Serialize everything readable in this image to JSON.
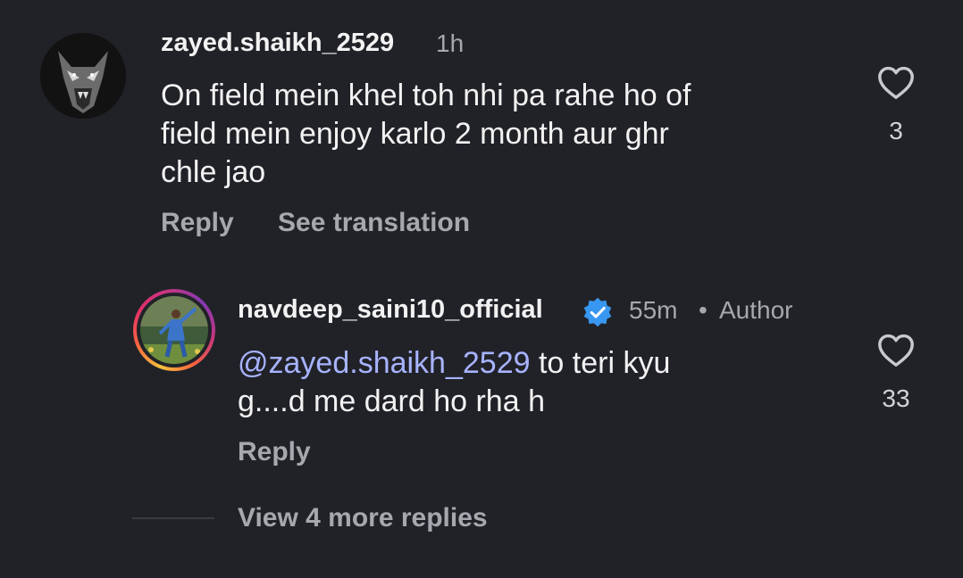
{
  "comment": {
    "username": "zayed.shaikh_2529",
    "time": "1h",
    "text_lines": [
      "On field mein khel toh nhi  pa rahe ho of",
      "field mein enjoy karlo 2 month aur ghr",
      "chle jao"
    ],
    "reply_label": "Reply",
    "translation_label": "See translation",
    "like_count": "3",
    "avatar_icon": "wolf-avatar-icon"
  },
  "reply": {
    "username": "navdeep_saini10_official",
    "verified_icon": "verified-badge-icon",
    "time": "55m",
    "separator": "•",
    "author_label": "Author",
    "mention": "@zayed.shaikh_2529",
    "text_after_mention": " to teri kyu",
    "text_line2": "g....d me dard ho rha h",
    "reply_label": "Reply",
    "like_count": "33",
    "avatar_icon": "cricketer-avatar-icon"
  },
  "view_more_label": "View 4 more replies",
  "colors": {
    "background": "#212228",
    "text": "#f2f2f2",
    "secondary": "#a6a8ae",
    "mention": "#a7b3ff",
    "verified": "#3897f0"
  }
}
